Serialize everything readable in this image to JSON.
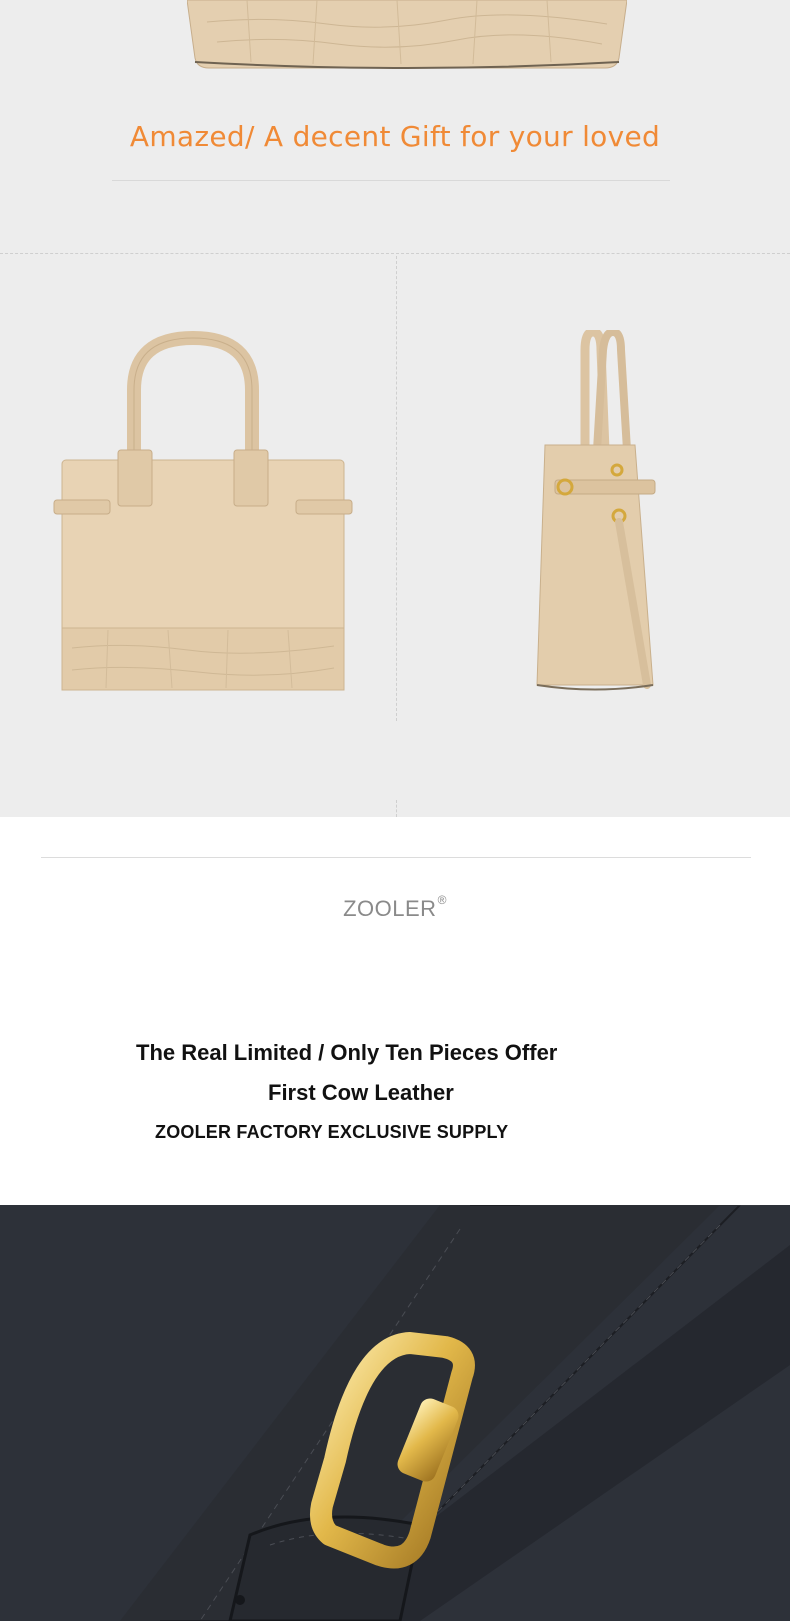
{
  "headline": "Amazed/  A decent Gift for your loved",
  "brand": {
    "name": "ZOOLER",
    "mark": "®"
  },
  "promo": {
    "line1": "The Real Limited / Only Ten Pieces Offer",
    "line2": "First Cow Leather",
    "line3": "ZOOLER FACTORY EXCLUSIVE SUPPLY"
  },
  "colors": {
    "headline": "#f08a36",
    "bag_beige": "#e7d2b3",
    "leather_dark": "#2d3139",
    "buckle_gold": "#e2b84a"
  },
  "images": {
    "top_bag_bottom": "beige-croc-bag-base",
    "front_view": "beige-tote-front",
    "side_view": "beige-tote-side",
    "detail": "black-leather-gold-buckle"
  }
}
